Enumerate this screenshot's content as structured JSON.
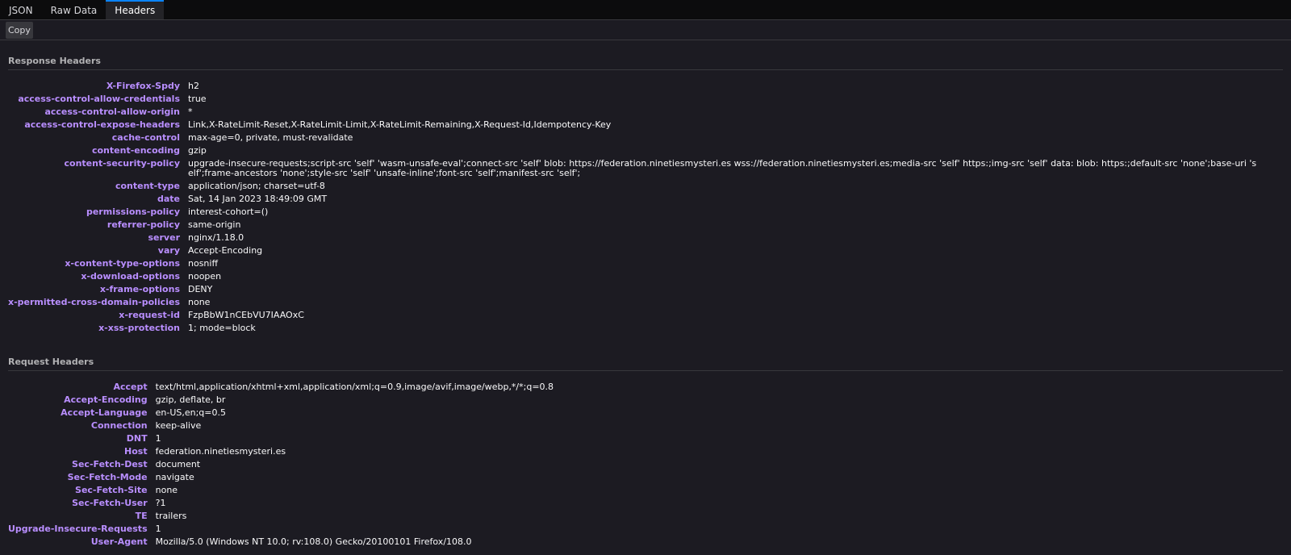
{
  "tabs": [
    {
      "label": "JSON"
    },
    {
      "label": "Raw Data"
    },
    {
      "label": "Headers"
    }
  ],
  "toolbar": {
    "copy_label": "Copy"
  },
  "response": {
    "title": "Response Headers",
    "headers": [
      {
        "name": "X-Firefox-Spdy",
        "value": "h2"
      },
      {
        "name": "access-control-allow-credentials",
        "value": "true"
      },
      {
        "name": "access-control-allow-origin",
        "value": "*"
      },
      {
        "name": "access-control-expose-headers",
        "value": "Link,X-RateLimit-Reset,X-RateLimit-Limit,X-RateLimit-Remaining,X-Request-Id,Idempotency-Key"
      },
      {
        "name": "cache-control",
        "value": "max-age=0, private, must-revalidate"
      },
      {
        "name": "content-encoding",
        "value": "gzip"
      },
      {
        "name": "content-security-policy",
        "value": "upgrade-insecure-requests;script-src 'self' 'wasm-unsafe-eval';connect-src 'self' blob: https://federation.ninetiesmysteri.es wss://federation.ninetiesmysteri.es;media-src 'self' https:;img-src 'self' data: blob: https:;default-src 'none';base-uri 'self';frame-ancestors 'none';style-src 'self' 'unsafe-inline';font-src 'self';manifest-src 'self';"
      },
      {
        "name": "content-type",
        "value": "application/json; charset=utf-8"
      },
      {
        "name": "date",
        "value": "Sat, 14 Jan 2023 18:49:09 GMT"
      },
      {
        "name": "permissions-policy",
        "value": "interest-cohort=()"
      },
      {
        "name": "referrer-policy",
        "value": "same-origin"
      },
      {
        "name": "server",
        "value": "nginx/1.18.0"
      },
      {
        "name": "vary",
        "value": "Accept-Encoding"
      },
      {
        "name": "x-content-type-options",
        "value": "nosniff"
      },
      {
        "name": "x-download-options",
        "value": "noopen"
      },
      {
        "name": "x-frame-options",
        "value": "DENY"
      },
      {
        "name": "x-permitted-cross-domain-policies",
        "value": "none"
      },
      {
        "name": "x-request-id",
        "value": "FzpBbW1nCEbVU7IAAOxC"
      },
      {
        "name": "x-xss-protection",
        "value": "1; mode=block"
      }
    ]
  },
  "request": {
    "title": "Request Headers",
    "headers": [
      {
        "name": "Accept",
        "value": "text/html,application/xhtml+xml,application/xml;q=0.9,image/avif,image/webp,*/*;q=0.8"
      },
      {
        "name": "Accept-Encoding",
        "value": "gzip, deflate, br"
      },
      {
        "name": "Accept-Language",
        "value": "en-US,en;q=0.5"
      },
      {
        "name": "Connection",
        "value": "keep-alive"
      },
      {
        "name": "DNT",
        "value": "1"
      },
      {
        "name": "Host",
        "value": "federation.ninetiesmysteri.es"
      },
      {
        "name": "Sec-Fetch-Dest",
        "value": "document"
      },
      {
        "name": "Sec-Fetch-Mode",
        "value": "navigate"
      },
      {
        "name": "Sec-Fetch-Site",
        "value": "none"
      },
      {
        "name": "Sec-Fetch-User",
        "value": "?1"
      },
      {
        "name": "TE",
        "value": "trailers"
      },
      {
        "name": "Upgrade-Insecure-Requests",
        "value": "1"
      },
      {
        "name": "User-Agent",
        "value": "Mozilla/5.0 (Windows NT 10.0; rv:108.0) Gecko/20100101 Firefox/108.0"
      }
    ]
  }
}
